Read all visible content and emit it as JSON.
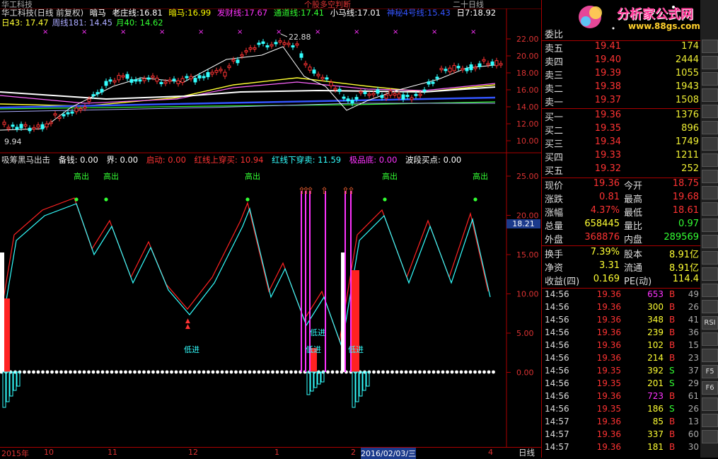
{
  "topbar": {
    "left": "华工科技",
    "mid": "个股多空判断",
    "right": "二十日线"
  },
  "title": {
    "stock": "华工科技(日线 前复权)",
    "items": [
      {
        "label": "暗马",
        "value": "",
        "color": "#ffffff"
      },
      {
        "label": "老庄线:",
        "value": "16.81",
        "color": "#ffffff"
      },
      {
        "label": "暗马:",
        "value": "16.99",
        "color": "#ffff00"
      },
      {
        "label": "发财线:",
        "value": "17.67",
        "color": "#ff33ff"
      },
      {
        "label": "通道线:",
        "value": "17.41",
        "color": "#33ff33"
      },
      {
        "label": "小马线:",
        "value": "17.01",
        "color": "#ffffff"
      },
      {
        "label": "神秘4号线:",
        "value": "15.43",
        "color": "#3355ff"
      },
      {
        "label": "日7:",
        "value": "18.92",
        "color": "#ffffff"
      }
    ],
    "line2": [
      {
        "label": "日43:",
        "value": "17.47",
        "color": "#ffff33"
      },
      {
        "label": "周线181:",
        "value": "14.45",
        "color": "#aaaaff"
      },
      {
        "label": "月40:",
        "value": "14.62",
        "color": "#33ff33"
      }
    ]
  },
  "price_axis": [
    "22.00",
    "20.00",
    "18.00",
    "16.00",
    "14.00",
    "12.00",
    "10.00"
  ],
  "price_marks": {
    "high": "22.88",
    "low": "9.94"
  },
  "indicator": {
    "name": "吸筹黑马出击",
    "items": [
      {
        "label": "备钱:",
        "value": "0.00",
        "color": "#ffffff"
      },
      {
        "label": "界:",
        "value": "0.00",
        "color": "#ffffff"
      },
      {
        "label": "启动:",
        "value": "0.00",
        "color": "#ff3333"
      },
      {
        "label": "红线上穿买:",
        "value": "10.94",
        "color": "#ff3333"
      },
      {
        "label": "红线下穿卖:",
        "value": "11.59",
        "color": "#33ffff"
      },
      {
        "label": "极品底:",
        "value": "0.00",
        "color": "#ff33ff"
      },
      {
        "label": "波段买点:",
        "value": "0.00",
        "color": "#ffffff"
      }
    ],
    "axis": [
      "25.00",
      "20.00",
      "15.00",
      "10.00",
      "5.00",
      "0.00"
    ],
    "current_tag": "18.21",
    "high_labels": [
      "高出",
      "高出",
      "高出",
      "高出",
      "高出"
    ],
    "low_labels": [
      "低进",
      "低进",
      "低进",
      "低进"
    ]
  },
  "date_axis": [
    "2015年",
    "10",
    "11",
    "12",
    "1",
    "2",
    "2016/02/03/三",
    "4"
  ],
  "period_button": "日线",
  "logo": {
    "brand": "分析家公式网",
    "url": "www.88gs.com"
  },
  "orderbook": {
    "header": "委比",
    "asks": [
      {
        "label": "卖五",
        "price": "19.41",
        "vol": "174"
      },
      {
        "label": "卖四",
        "price": "19.40",
        "vol": "2444"
      },
      {
        "label": "卖三",
        "price": "19.39",
        "vol": "1055"
      },
      {
        "label": "卖二",
        "price": "19.38",
        "vol": "1943"
      },
      {
        "label": "卖一",
        "price": "19.37",
        "vol": "1508"
      }
    ],
    "bids": [
      {
        "label": "买一",
        "price": "19.36",
        "vol": "1376"
      },
      {
        "label": "买二",
        "price": "19.35",
        "vol": "896"
      },
      {
        "label": "买三",
        "price": "19.34",
        "vol": "1749"
      },
      {
        "label": "买四",
        "price": "19.33",
        "vol": "1211"
      },
      {
        "label": "买五",
        "price": "19.32",
        "vol": "252"
      }
    ]
  },
  "quote": [
    {
      "l1": "现价",
      "v1": "19.36",
      "c1": "#ff3333",
      "l2": "今开",
      "v2": "18.75",
      "c2": "#ff3333"
    },
    {
      "l1": "涨跌",
      "v1": "0.81",
      "c1": "#ff3333",
      "l2": "最高",
      "v2": "19.68",
      "c2": "#ff3333"
    },
    {
      "l1": "涨幅",
      "v1": "4.37%",
      "c1": "#ff3333",
      "l2": "最低",
      "v2": "18.61",
      "c2": "#ff3333"
    },
    {
      "l1": "总量",
      "v1": "658445",
      "c1": "#ffff33",
      "l2": "量比",
      "v2": "0.97",
      "c2": "#33ff33"
    },
    {
      "l1": "外盘",
      "v1": "368876",
      "c1": "#ff3333",
      "l2": "内盘",
      "v2": "289569",
      "c2": "#33ff33"
    },
    {
      "l1": "换手",
      "v1": "7.39%",
      "c1": "#ffff33",
      "l2": "股本",
      "v2": "8.91亿",
      "c2": "#ffff33"
    },
    {
      "l1": "净资",
      "v1": "3.31",
      "c1": "#ffff33",
      "l2": "流通",
      "v2": "8.91亿",
      "c2": "#ffff33"
    },
    {
      "l1": "收益(四)",
      "v1": "0.169",
      "c1": "#ffff33",
      "l2": "PE(动)",
      "v2": "114.4",
      "c2": "#ffff33"
    }
  ],
  "ticks": [
    {
      "time": "14:56",
      "price": "19.36",
      "vol": "653",
      "dir": "B",
      "n": "49",
      "vc": "#ff33ff"
    },
    {
      "time": "14:56",
      "price": "19.36",
      "vol": "300",
      "dir": "B",
      "n": "26",
      "vc": "#ffff33"
    },
    {
      "time": "14:56",
      "price": "19.36",
      "vol": "348",
      "dir": "B",
      "n": "41",
      "vc": "#ffff33"
    },
    {
      "time": "14:56",
      "price": "19.36",
      "vol": "239",
      "dir": "B",
      "n": "36",
      "vc": "#ffff33"
    },
    {
      "time": "14:56",
      "price": "19.36",
      "vol": "102",
      "dir": "B",
      "n": "15",
      "vc": "#ffff33"
    },
    {
      "time": "14:56",
      "price": "19.36",
      "vol": "214",
      "dir": "B",
      "n": "23",
      "vc": "#ffff33"
    },
    {
      "time": "14:56",
      "price": "19.35",
      "vol": "392",
      "dir": "S",
      "n": "37",
      "vc": "#ffff33"
    },
    {
      "time": "14:56",
      "price": "19.35",
      "vol": "201",
      "dir": "S",
      "n": "29",
      "vc": "#ffff33"
    },
    {
      "time": "14:56",
      "price": "19.36",
      "vol": "723",
      "dir": "B",
      "n": "61",
      "vc": "#ff33ff"
    },
    {
      "time": "14:56",
      "price": "19.35",
      "vol": "186",
      "dir": "S",
      "n": "26",
      "vc": "#ffff33"
    },
    {
      "time": "14:57",
      "price": "19.36",
      "vol": "85",
      "dir": "B",
      "n": "13",
      "vc": "#ffff33"
    },
    {
      "time": "14:57",
      "price": "19.36",
      "vol": "337",
      "dir": "B",
      "n": "60",
      "vc": "#ffff33"
    },
    {
      "time": "14:57",
      "price": "19.36",
      "vol": "181",
      "dir": "B",
      "n": "30",
      "vc": "#ffff33"
    }
  ],
  "toolbar_buttons": [
    "",
    "",
    "",
    "",
    "",
    "",
    "",
    "",
    "",
    "",
    "",
    "",
    "",
    "",
    "",
    "",
    "",
    "RSI",
    "",
    "",
    "F5",
    "F6",
    "",
    "",
    ""
  ]
}
